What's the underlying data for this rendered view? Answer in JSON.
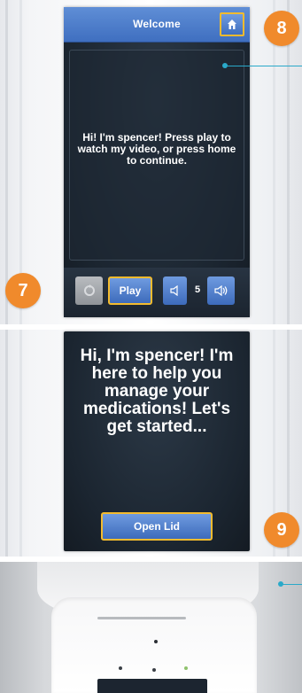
{
  "panel1": {
    "title": "Welcome",
    "home_icon": "home-icon",
    "video_message": "Hi! I'm spencer! Press play to watch my video, or press home to continue.",
    "controls": {
      "replay_icon": "replay-icon",
      "play_label": "Play",
      "volume_down_icon": "volume-down-icon",
      "volume_level": "5",
      "volume_up_icon": "volume-up-icon"
    }
  },
  "callouts": {
    "seven": "7",
    "eight": "8",
    "nine": "9"
  },
  "panel2": {
    "message": "Hi, I'm spencer! I'm here to help you manage your medications! Let's get started...",
    "open_lid_label": "Open Lid"
  },
  "colors": {
    "accent_blue": "#4a7bd0",
    "highlight": "#f3bb2e",
    "callout": "#f08a2c",
    "leader": "#2aa9c9",
    "screen_bg": "#1b2530"
  }
}
